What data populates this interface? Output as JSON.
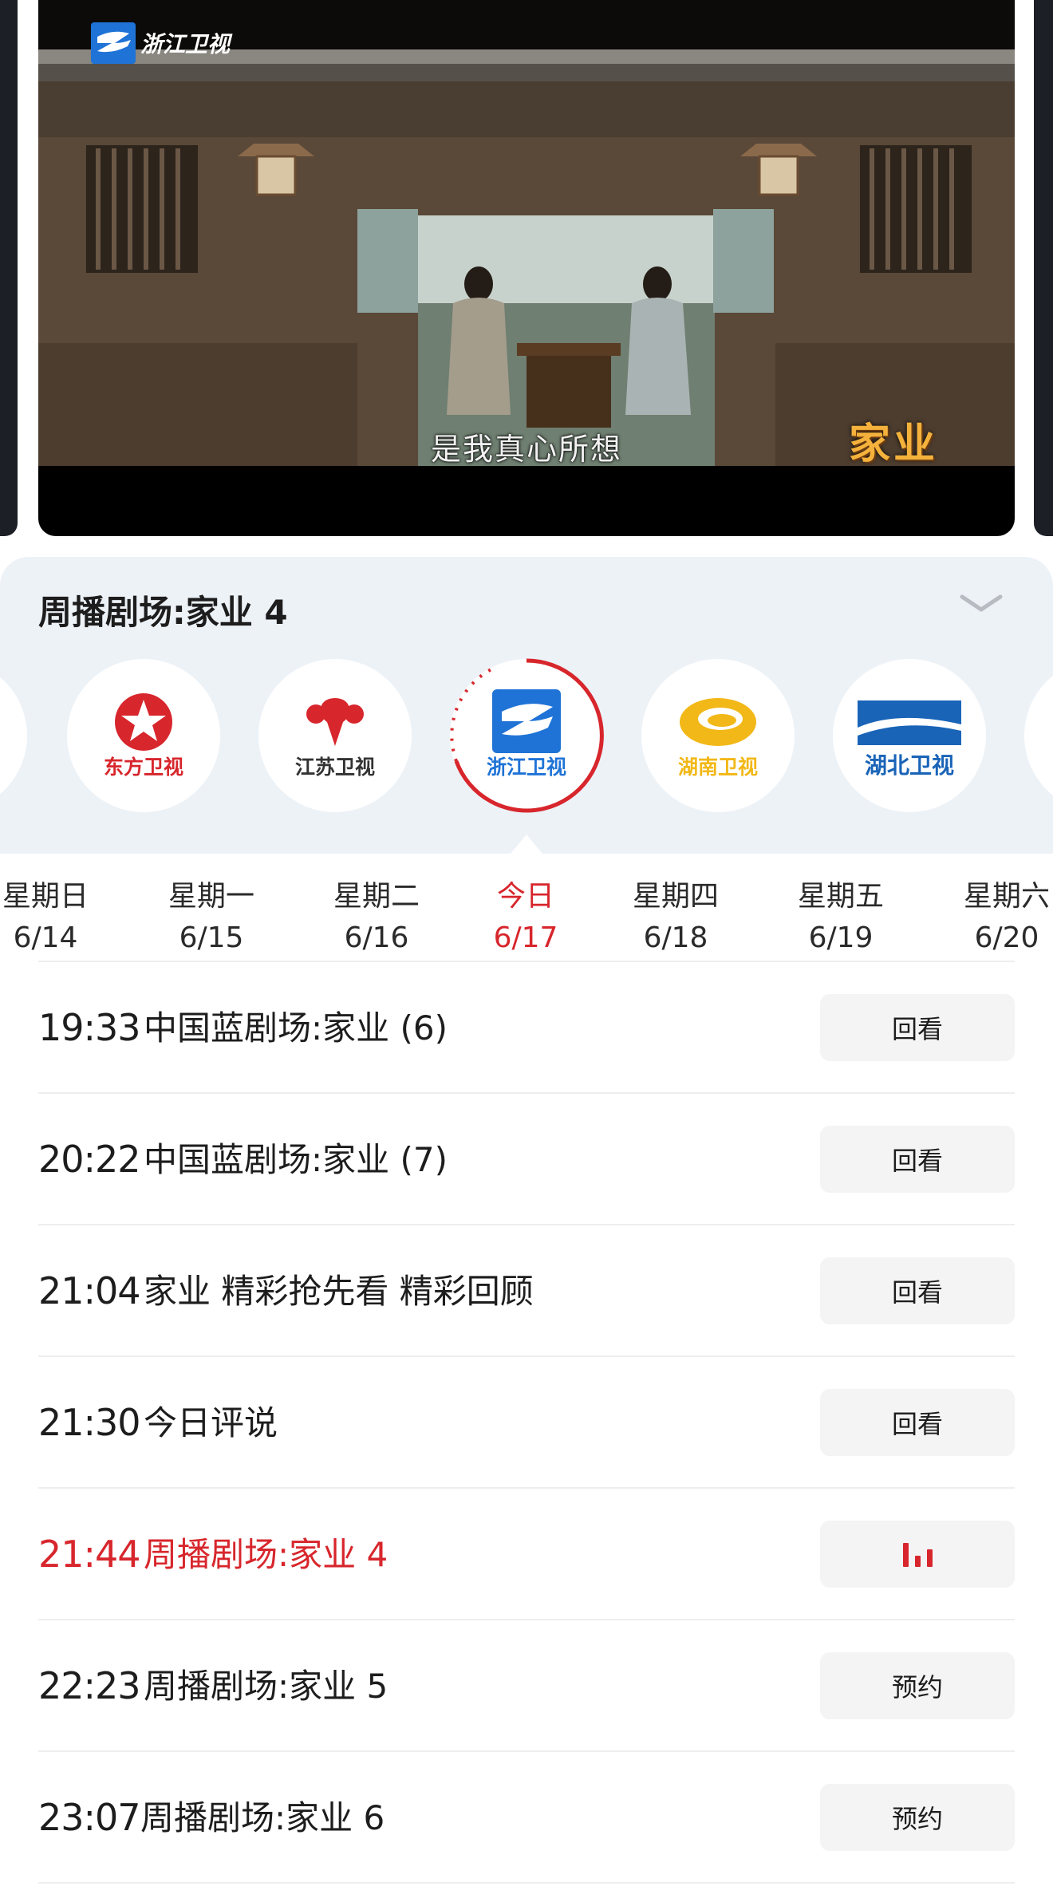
{
  "player": {
    "watermark": "浙江卫视",
    "subtitle": "是我真心所想",
    "show_logo": "家业"
  },
  "program": {
    "title": "周播剧场:家业 4"
  },
  "channels": [
    {
      "name": "东方卫视",
      "color": "#d7262c"
    },
    {
      "name": "江苏卫视",
      "color": "#d7262c"
    },
    {
      "name": "浙江卫视",
      "color": "#1f73d6",
      "selected": true
    },
    {
      "name": "湖南卫视",
      "color": "#f2b817"
    },
    {
      "name": "湖北卫视",
      "color": "#1a64b8"
    }
  ],
  "dates": [
    {
      "weekday": "星期日",
      "date": "6/14"
    },
    {
      "weekday": "星期一",
      "date": "6/15"
    },
    {
      "weekday": "星期二",
      "date": "6/16"
    },
    {
      "weekday": "今日",
      "date": "6/17",
      "active": true
    },
    {
      "weekday": "星期四",
      "date": "6/18"
    },
    {
      "weekday": "星期五",
      "date": "6/19"
    },
    {
      "weekday": "星期六",
      "date": "6/20"
    }
  ],
  "schedule": [
    {
      "time": "19:33",
      "title": "中国蓝剧场:家业 (6)",
      "action": "回看"
    },
    {
      "time": "20:22",
      "title": "中国蓝剧场:家业 (7)",
      "action": "回看"
    },
    {
      "time": "21:04",
      "title": "家业 精彩抢先看 精彩回顾",
      "action": "回看"
    },
    {
      "time": "21:30",
      "title": "今日评说",
      "action": "回看"
    },
    {
      "time": "21:44",
      "title": "周播剧场:家业 4",
      "action": "",
      "live": true,
      "action_icon": "playing-bars-icon"
    },
    {
      "time": "22:23",
      "title": "周播剧场:家业 5",
      "action": "预约"
    },
    {
      "time": "23:07",
      "title": "周播剧场:家业 6",
      "action": "预约"
    }
  ],
  "colors": {
    "accent": "#d7262c",
    "panel_bg": "#edf2f7",
    "button_bg": "#f4f4f4"
  }
}
